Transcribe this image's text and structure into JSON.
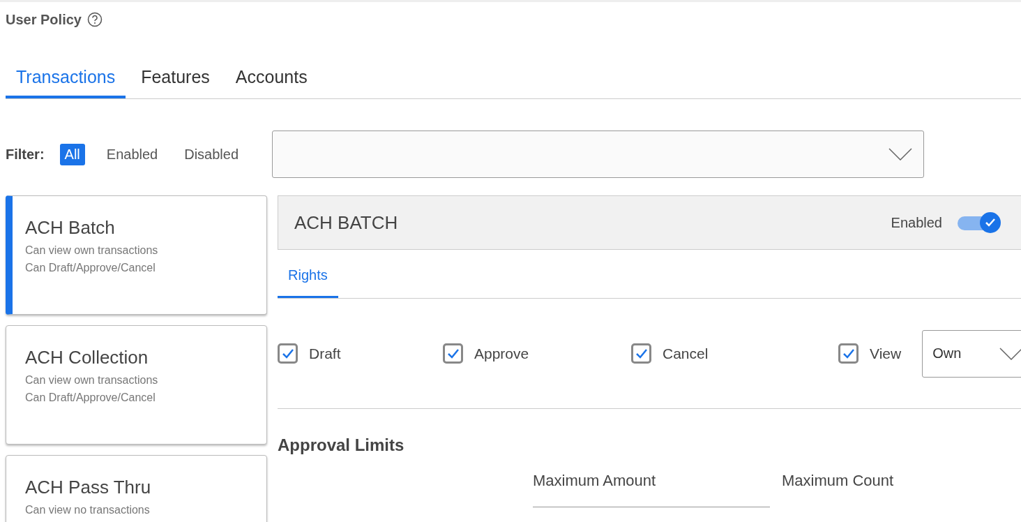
{
  "page": {
    "title": "User Policy"
  },
  "tabs": [
    {
      "label": "Transactions",
      "selected": true
    },
    {
      "label": "Features",
      "selected": false
    },
    {
      "label": "Accounts",
      "selected": false
    }
  ],
  "filter": {
    "label": "Filter:",
    "options": [
      {
        "label": "All",
        "selected": true
      },
      {
        "label": "Enabled",
        "selected": false
      },
      {
        "label": "Disabled",
        "selected": false
      }
    ]
  },
  "transactions": [
    {
      "name": "ACH Batch",
      "lines": [
        "Can view own transactions",
        "Can Draft/Approve/Cancel"
      ],
      "selected": true
    },
    {
      "name": "ACH Collection",
      "lines": [
        "Can view own transactions",
        "Can Draft/Approve/Cancel"
      ],
      "selected": false
    },
    {
      "name": "ACH Pass Thru",
      "lines": [
        "Can view no transactions"
      ],
      "selected": false
    }
  ],
  "detail": {
    "title": "ACH BATCH",
    "status_label": "Enabled",
    "enabled": true,
    "tabs": [
      {
        "label": "Rights",
        "selected": true
      }
    ],
    "rights": [
      {
        "kind": "checkbox",
        "label": "Draft",
        "checked": true
      },
      {
        "kind": "checkbox",
        "label": "Approve",
        "checked": true
      },
      {
        "kind": "checkbox",
        "label": "Cancel",
        "checked": true
      },
      {
        "kind": "select",
        "label": "View",
        "checked": true,
        "value": "Own"
      }
    ],
    "limits": {
      "title": "Approval Limits",
      "columns": [
        "Maximum Amount",
        "Maximum Count"
      ]
    }
  }
}
